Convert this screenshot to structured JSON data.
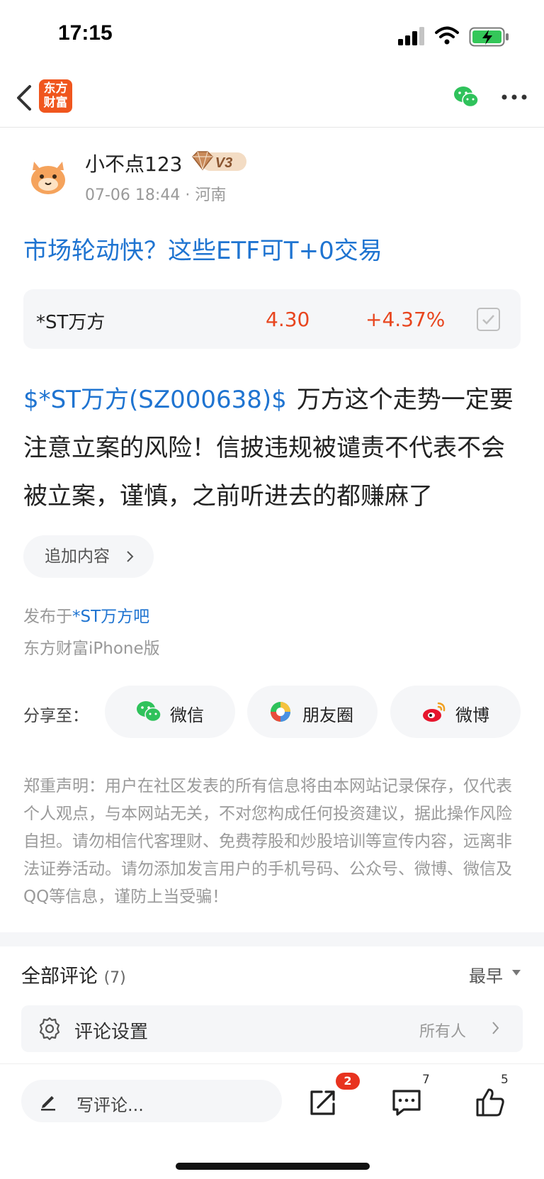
{
  "status_bar": {
    "time": "17:15"
  },
  "nav": {
    "logo_line1": "东方",
    "logo_line2": "财富"
  },
  "author": {
    "name": "小不点123",
    "level": "V3",
    "date": "07-06 18:44",
    "separator": "·",
    "location": "河南"
  },
  "post": {
    "title": "市场轮动快？这些ETF可T+0交易",
    "stock_card": {
      "name": "*ST万方",
      "price": "4.30",
      "change": "+4.37%"
    },
    "stock_link": "$*ST万方(SZ000638)$",
    "body": "万方这个走势一定要注意立案的风险！信披违规被谴责不代表不会被立案，谨慎，之前听进去的都赚麻了",
    "add_content": "追加内容",
    "published_in_prefix": "发布于",
    "forum": "*ST万方吧",
    "client": "东方财富iPhone版"
  },
  "share": {
    "label": "分享至：",
    "wechat": "微信",
    "moments": "朋友圈",
    "weibo": "微博"
  },
  "disclaimer": "郑重声明：用户在社区发表的所有信息将由本网站记录保存，仅代表个人观点，与本网站无关，不对您构成任何投资建议，据此操作风险自担。请勿相信代客理财、免费荐股和炒股培训等宣传内容，远离非法证券活动。请勿添加发言用户的手机号码、公众号、微博、微信及QQ等信息，谨防上当受骗！",
  "comments": {
    "title": "全部评论",
    "count": "(7)",
    "sort": "最早",
    "settings_label": "评论设置",
    "settings_value": "所有人"
  },
  "bottom_bar": {
    "placeholder": "写评论...",
    "share_badge": "2",
    "comment_count": "7",
    "like_count": "5"
  },
  "colors": {
    "brand": "#f0561e",
    "link": "#1f74d1",
    "up": "#e8451e",
    "badge": "#e8331f"
  }
}
